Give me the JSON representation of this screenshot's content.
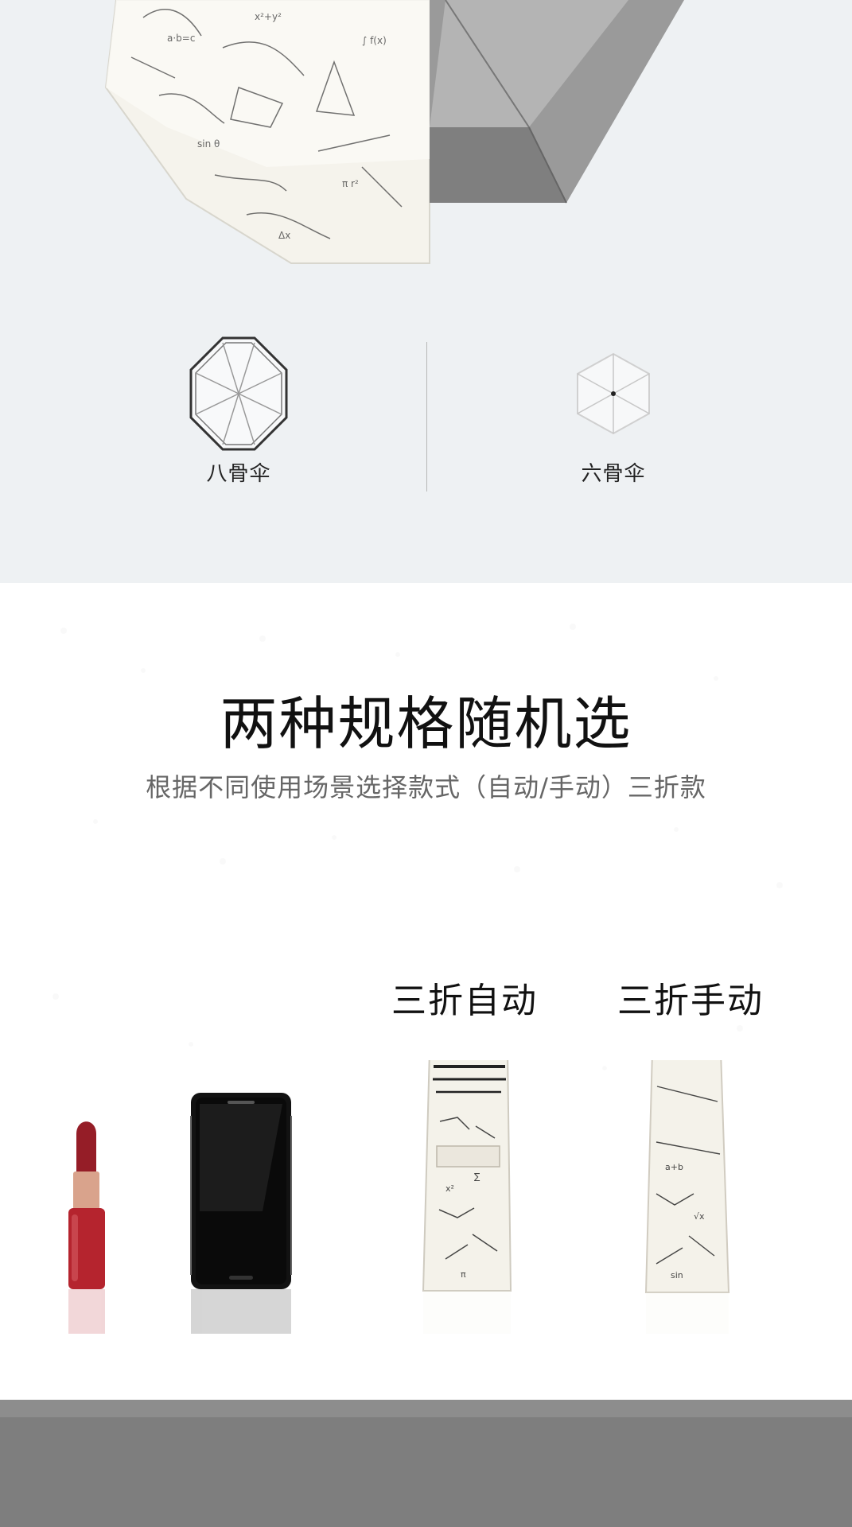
{
  "spec_section": {
    "left_label": "八骨伞",
    "right_label": "六骨伞"
  },
  "headline": "两种规格随机选",
  "subheadline": "根据不同使用场景选择款式（自动/手动）三折款",
  "models": [
    {
      "label": "三折自动"
    },
    {
      "label": "三折手动"
    }
  ],
  "icons": {
    "left": "eight-rib-umbrella-icon",
    "right": "six-rib-umbrella-icon"
  },
  "colors": {
    "top_background": "#eef1f3",
    "bottom_background": "#ffffff",
    "floor": "#7e7e7e",
    "umbrella_canopy": "#f4f2ea",
    "umbrella_handle": "#111111",
    "lipstick": "#a8232d"
  }
}
